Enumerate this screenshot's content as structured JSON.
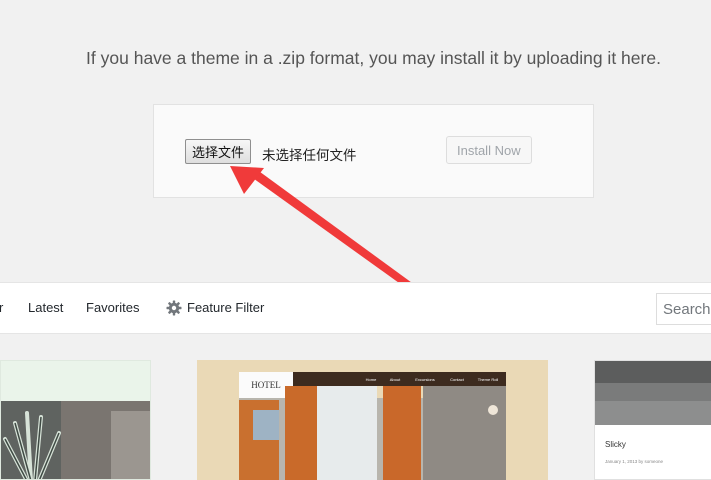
{
  "upload": {
    "intro_text": "If you have a theme in a .zip format, you may install it by uploading it here.",
    "choose_file_label": "选择文件",
    "no_file_text": "未选择任何文件",
    "install_label": "Install Now"
  },
  "filters": {
    "partial_item": "r",
    "latest": "Latest",
    "favorites": "Favorites",
    "feature_filter": "Feature Filter",
    "search_placeholder": "Search"
  },
  "themes": [
    {},
    {
      "logo": "HOTEL",
      "nav": [
        "Home",
        "About",
        "Excursions",
        "Contact",
        "Theme Roll"
      ]
    },
    {
      "title": "Slicky",
      "meta": "January 1, 2013 by someone"
    }
  ],
  "colors": {
    "arrow": "#f03a3a",
    "background": "#f1f1f1"
  }
}
